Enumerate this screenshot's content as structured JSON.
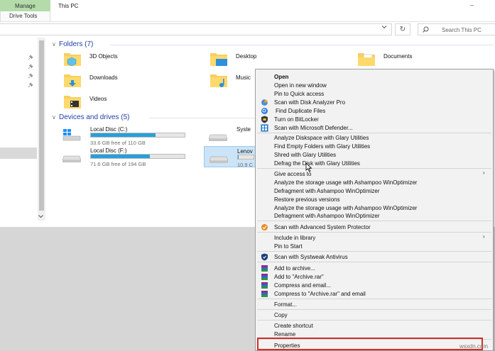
{
  "ribbon": {
    "manage_tab": "Manage",
    "drive_tools_tab": "Drive Tools",
    "window_title": "This PC",
    "minimize_glyph": "–"
  },
  "address_bar": {
    "refresh_glyph": "↻",
    "search_placeholder": "Search This PC"
  },
  "sections": {
    "folders_header": "Folders (7)",
    "devices_header": "Devices and drives (5)"
  },
  "folders": [
    {
      "name": "3D Objects",
      "icon": "3d-objects-folder-icon"
    },
    {
      "name": "Desktop",
      "icon": "desktop-folder-icon"
    },
    {
      "name": "Documents",
      "icon": "documents-folder-icon"
    },
    {
      "name": "Downloads",
      "icon": "downloads-folder-icon"
    },
    {
      "name": "Music",
      "icon": "music-folder-icon"
    },
    {
      "name": "Videos",
      "icon": "videos-folder-icon"
    }
  ],
  "drives": [
    {
      "name": "Local Disc (C:)",
      "free": "33.6 GB free of 110 GB",
      "used_fraction": 0.69
    },
    {
      "name": "Syste",
      "free": "",
      "used_fraction": 0.0
    },
    {
      "name": "Local Disc (F:)",
      "free": "71.6 GB free of 194 GB",
      "used_fraction": 0.63
    },
    {
      "name": "Lenov",
      "free": "10.9 C",
      "used_fraction": 0.02
    }
  ],
  "context_menu": {
    "items": [
      "Open",
      "Open in new window",
      "Pin to Quick access",
      "Scan with Disk Analyzer Pro",
      "Find Duplicate Files",
      "Turn on BitLocker",
      "Scan with Microsoft Defender...",
      "Analyze Diskspace with Glary Utilities",
      "Find Empty Folders with Glary Utilities",
      "Shred with Glary Utilities",
      "Defrag the Disk with Glary Utilities",
      "Give access to",
      "Analyze the storage usage with Ashampoo WinOptimizer",
      "Defragment with Ashampoo WinOptimizer",
      "Restore previous versions",
      "Analyze the storage usage with Ashampoo WinOptimizer",
      "Defragment with Ashampoo WinOptimizer",
      "Scan with Advanced System Protector",
      "Include in library",
      "Pin to Start",
      "Scan with Systweak Antivirus",
      "Add to archive...",
      "Add to \"Archive.rar\"",
      "Compress and email...",
      "Compress to \"Archive.rar\" and email",
      "Format...",
      "Copy",
      "Create shortcut",
      "Rename",
      "Properties"
    ],
    "submenu_arrow": "›"
  },
  "watermark": "wsxdn.com",
  "colors": {
    "manage_tab": "#b4dcaa",
    "section_header": "#1e3fa8",
    "drive_fill": "#26a0da",
    "selection": "#cce4f7",
    "highlight_border": "#d0302a"
  }
}
